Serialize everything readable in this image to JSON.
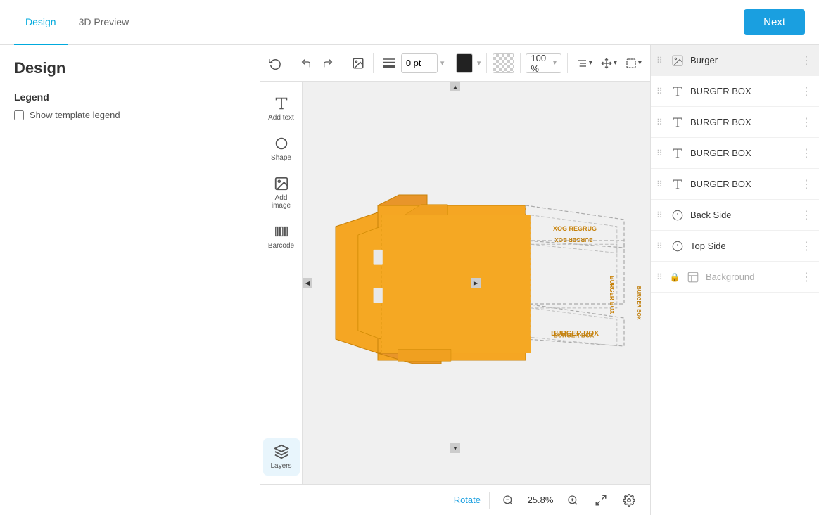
{
  "tabs": [
    {
      "id": "design",
      "label": "Design",
      "active": true
    },
    {
      "id": "3d-preview",
      "label": "3D Preview",
      "active": false
    }
  ],
  "next_button": "Next",
  "page_title": "Design",
  "legend": {
    "title": "Legend",
    "show_template_label": "Show template legend"
  },
  "toolbar": {
    "stroke_value": "0 pt",
    "zoom_percent": "100 %"
  },
  "tools": [
    {
      "id": "add-text",
      "label": "Add text"
    },
    {
      "id": "shape",
      "label": "Shape"
    },
    {
      "id": "add-image",
      "label": "Add image"
    },
    {
      "id": "barcode",
      "label": "Barcode"
    },
    {
      "id": "layers",
      "label": "Layers",
      "active": true
    }
  ],
  "layers": [
    {
      "id": "burger",
      "name": "Burger",
      "type": "image",
      "active": true
    },
    {
      "id": "burger-box-1",
      "name": "BURGER BOX",
      "type": "text"
    },
    {
      "id": "burger-box-2",
      "name": "BURGER BOX",
      "type": "text"
    },
    {
      "id": "burger-box-3",
      "name": "BURGER BOX",
      "type": "text"
    },
    {
      "id": "burger-box-4",
      "name": "BURGER BOX",
      "type": "text"
    },
    {
      "id": "back-side",
      "name": "Back Side",
      "type": "shape"
    },
    {
      "id": "top-side",
      "name": "Top Side",
      "type": "shape"
    },
    {
      "id": "background",
      "name": "Background",
      "type": "pattern",
      "locked": true
    }
  ],
  "bottom": {
    "rotate_label": "Rotate",
    "zoom_value": "25.8%"
  }
}
